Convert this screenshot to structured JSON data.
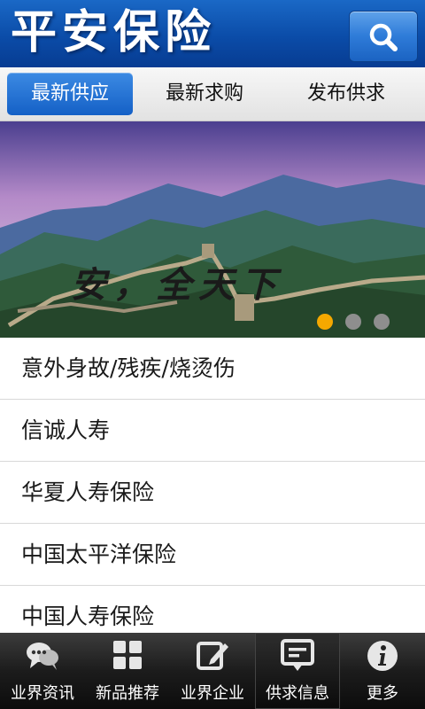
{
  "header": {
    "title": "平安保险",
    "search_icon": "search-icon"
  },
  "tabs": [
    {
      "label": "最新供应",
      "active": true
    },
    {
      "label": "最新求购",
      "active": false
    },
    {
      "label": "发布供求",
      "active": false
    }
  ],
  "banner": {
    "slogan": "安，全天下",
    "dots": {
      "count": 3,
      "active_index": 0
    }
  },
  "list": {
    "items": [
      {
        "label": "意外身故/残疾/烧烫伤"
      },
      {
        "label": "信诚人寿"
      },
      {
        "label": "华夏人寿保险"
      },
      {
        "label": "中国太平洋保险"
      },
      {
        "label": "中国人寿保险"
      }
    ]
  },
  "bottom_nav": {
    "items": [
      {
        "label": "业界资讯",
        "icon": "chat-bubbles-icon",
        "active": false
      },
      {
        "label": "新品推荐",
        "icon": "grid-icon",
        "active": false
      },
      {
        "label": "业界企业",
        "icon": "edit-icon",
        "active": false
      },
      {
        "label": "供求信息",
        "icon": "message-icon",
        "active": true
      },
      {
        "label": "更多",
        "icon": "info-icon",
        "active": false
      }
    ]
  },
  "colors": {
    "header_blue": "#0b4ca8",
    "active_tab": "#1460c6",
    "dot_active": "#f5a800",
    "nav_bg": "#1c1c1c"
  }
}
